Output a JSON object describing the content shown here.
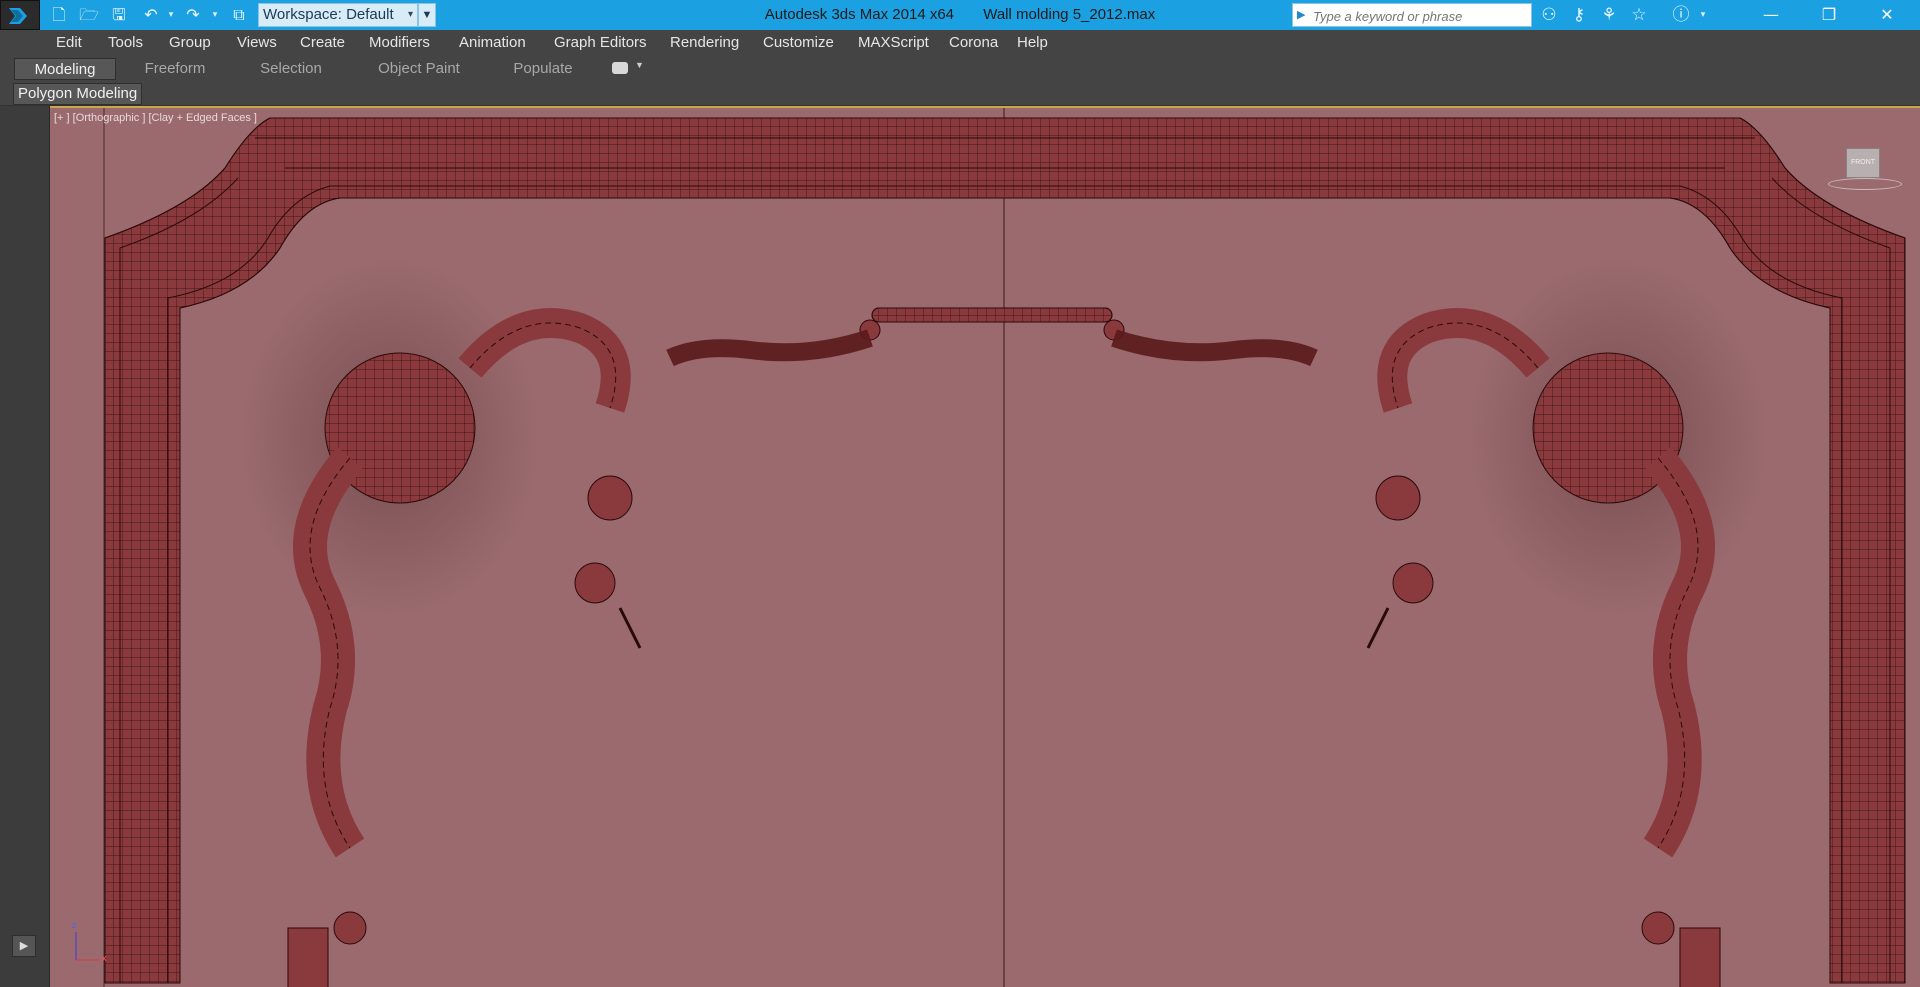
{
  "titlebar": {
    "app_title": "Autodesk 3ds Max  2014 x64",
    "file_title": "Wall molding 5_2012.max",
    "workspace_label": "Workspace: Default",
    "search_placeholder": "Type a keyword or phrase",
    "quick_access_icons": [
      "new-file-icon",
      "open-file-icon",
      "save-icon",
      "undo-icon",
      "redo-icon",
      "project-folder-icon"
    ],
    "search_tool_icons": [
      "binoculars-icon",
      "key-icon",
      "subscription-icon",
      "favorites-star-icon",
      "help-icon"
    ],
    "window_controls": {
      "minimize": "—",
      "restore": "❐",
      "close": "✕"
    }
  },
  "menubar": {
    "items": [
      "Edit",
      "Tools",
      "Group",
      "Views",
      "Create",
      "Modifiers",
      "Animation",
      "Graph Editors",
      "Rendering",
      "Customize",
      "MAXScript",
      "Corona",
      "Help"
    ]
  },
  "ribbon": {
    "tabs": [
      {
        "label": "Modeling",
        "active": true
      },
      {
        "label": "Freeform",
        "active": false
      },
      {
        "label": "Selection",
        "active": false
      },
      {
        "label": "Object Paint",
        "active": false
      },
      {
        "label": "Populate",
        "active": false
      }
    ],
    "panel_label": "Polygon Modeling"
  },
  "viewport": {
    "label": "[+ ] [Orthographic ] [Clay + Edged Faces ]",
    "viewcube_label": "FRONT",
    "axis_labels": {
      "z": "z",
      "x": "x"
    },
    "background_color": "#9a6a6e",
    "model_color": "#8a3a3c",
    "wire_color": "#2a0a0a",
    "active_border_color": "#c8a64a"
  }
}
